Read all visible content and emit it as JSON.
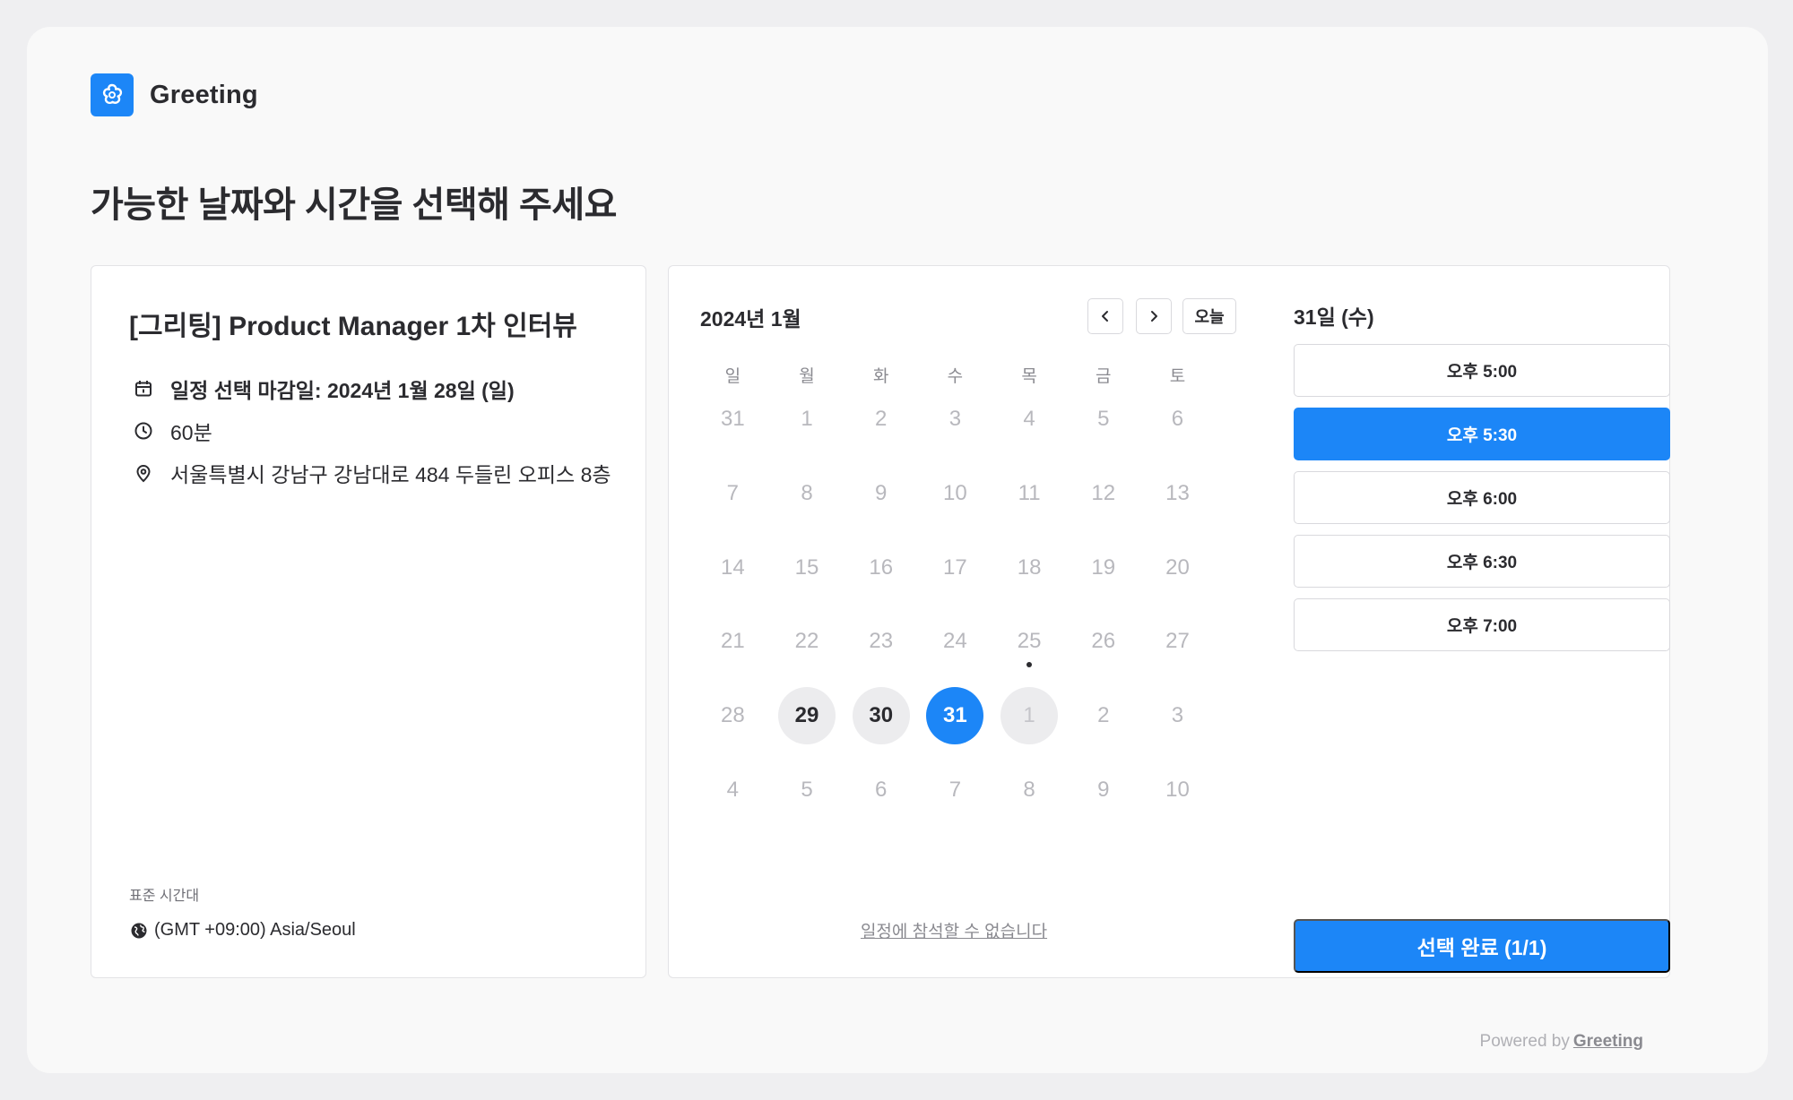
{
  "brand": {
    "name": "Greeting",
    "logo_icon": "flower-icon",
    "color": "#1c86f7"
  },
  "page": {
    "title": "가능한 날짜와 시간을 선택해 주세요"
  },
  "event": {
    "title": "[그리팅] Product Manager 1차 인터뷰",
    "deadline": "일정 선택 마감일: 2024년 1월 28일 (일)",
    "duration": "60분",
    "location": "서울특별시 강남구 강남대로 484 두들린 오피스 8층",
    "timezone_caption": "표준 시간대",
    "timezone": "(GMT +09:00) Asia/Seoul"
  },
  "calendar": {
    "month_label": "2024년 1월",
    "today_label": "오늘",
    "weekdays": [
      "일",
      "월",
      "화",
      "수",
      "목",
      "금",
      "토"
    ],
    "days": [
      {
        "d": "31",
        "s": "muted"
      },
      {
        "d": "1",
        "s": "muted"
      },
      {
        "d": "2",
        "s": "muted"
      },
      {
        "d": "3",
        "s": "muted"
      },
      {
        "d": "4",
        "s": "muted"
      },
      {
        "d": "5",
        "s": "muted"
      },
      {
        "d": "6",
        "s": "muted"
      },
      {
        "d": "7",
        "s": "muted"
      },
      {
        "d": "8",
        "s": "muted"
      },
      {
        "d": "9",
        "s": "muted"
      },
      {
        "d": "10",
        "s": "muted"
      },
      {
        "d": "11",
        "s": "muted"
      },
      {
        "d": "12",
        "s": "muted"
      },
      {
        "d": "13",
        "s": "muted"
      },
      {
        "d": "14",
        "s": "muted"
      },
      {
        "d": "15",
        "s": "muted"
      },
      {
        "d": "16",
        "s": "muted"
      },
      {
        "d": "17",
        "s": "muted"
      },
      {
        "d": "18",
        "s": "muted"
      },
      {
        "d": "19",
        "s": "muted"
      },
      {
        "d": "20",
        "s": "muted"
      },
      {
        "d": "21",
        "s": "muted"
      },
      {
        "d": "22",
        "s": "muted"
      },
      {
        "d": "23",
        "s": "muted"
      },
      {
        "d": "24",
        "s": "muted"
      },
      {
        "d": "25",
        "s": "muted",
        "today": true
      },
      {
        "d": "26",
        "s": "muted"
      },
      {
        "d": "27",
        "s": "muted"
      },
      {
        "d": "28",
        "s": "muted"
      },
      {
        "d": "29",
        "s": "available"
      },
      {
        "d": "30",
        "s": "available"
      },
      {
        "d": "31",
        "s": "selected"
      },
      {
        "d": "1",
        "s": "faded"
      },
      {
        "d": "2",
        "s": "muted"
      },
      {
        "d": "3",
        "s": "muted"
      },
      {
        "d": "4",
        "s": "muted"
      },
      {
        "d": "5",
        "s": "muted"
      },
      {
        "d": "6",
        "s": "muted"
      },
      {
        "d": "7",
        "s": "muted"
      },
      {
        "d": "8",
        "s": "muted"
      },
      {
        "d": "9",
        "s": "muted"
      },
      {
        "d": "10",
        "s": "muted"
      }
    ],
    "cant_attend": "일정에 참석할 수 없습니다"
  },
  "schedule": {
    "selected_date": "31일 (수)",
    "slots": [
      {
        "label": "오후 5:00",
        "active": false
      },
      {
        "label": "오후 5:30",
        "active": true
      },
      {
        "label": "오후 6:00",
        "active": false
      },
      {
        "label": "오후 6:30",
        "active": false
      },
      {
        "label": "오후 7:00",
        "active": false
      }
    ],
    "confirm_label": "선택 완료 (1/1)"
  },
  "footer": {
    "powered_by": "Powered by",
    "brand_link": "Greeting"
  }
}
